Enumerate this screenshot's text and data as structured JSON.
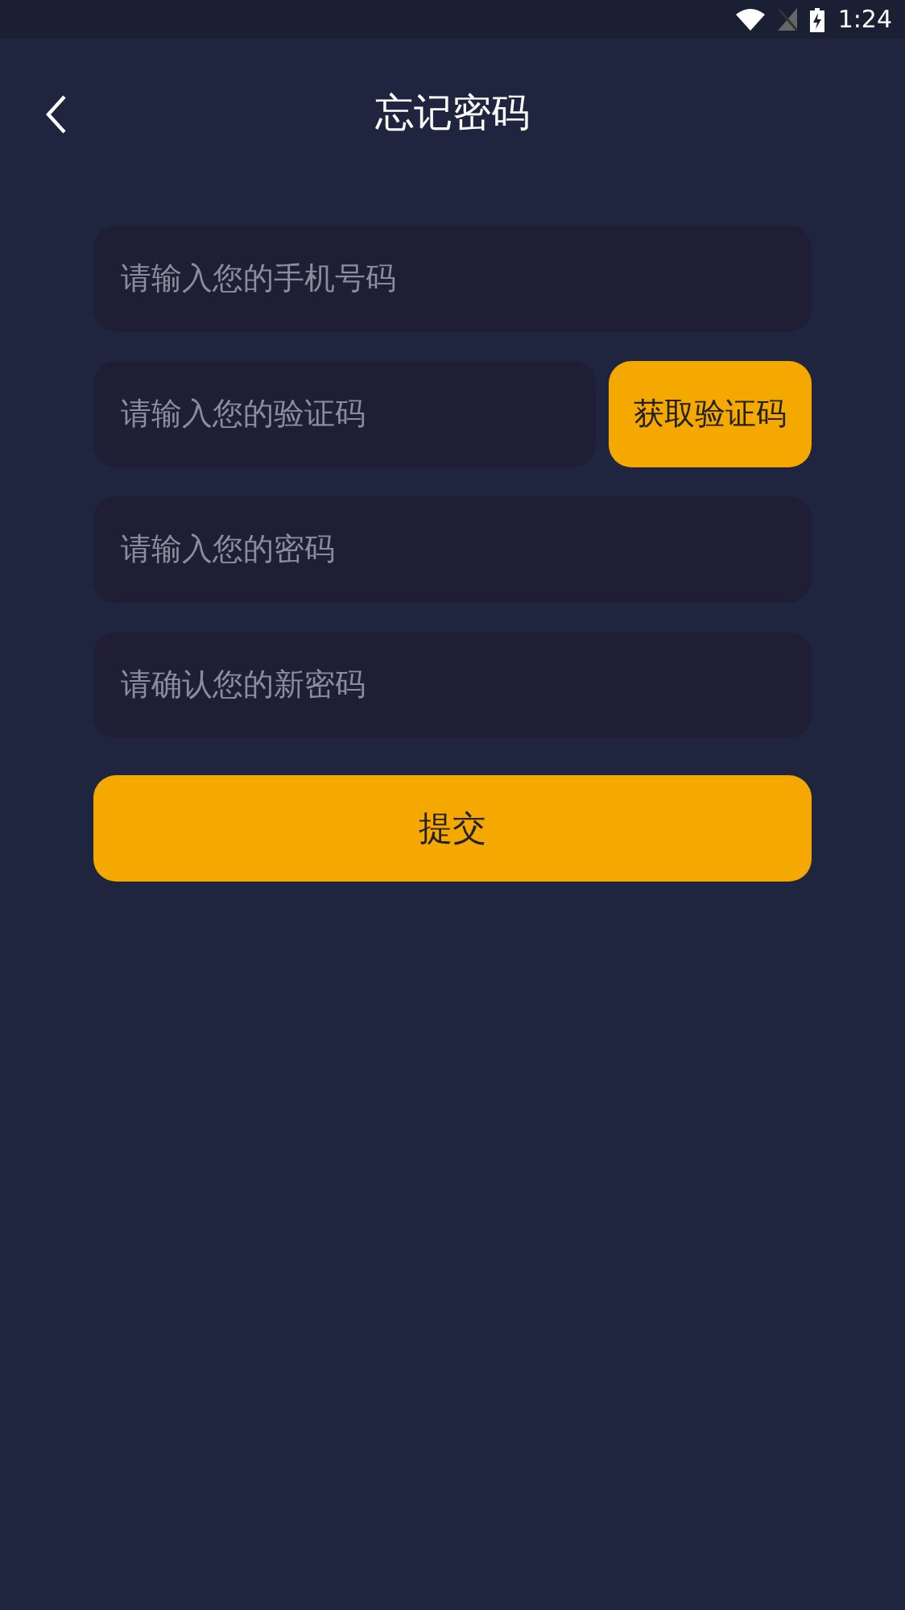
{
  "status_bar": {
    "time": "1:24"
  },
  "header": {
    "title": "忘记密码"
  },
  "fields": [
    {
      "kind": "text",
      "placeholder": "请输入您的手机号码"
    },
    {
      "kind": "code",
      "placeholder": "请输入您的验证码",
      "button": "获取验证码"
    },
    {
      "kind": "text",
      "placeholder": "请输入您的密码"
    },
    {
      "kind": "text",
      "placeholder": "请确认您的新密码"
    }
  ],
  "submit": "提交"
}
